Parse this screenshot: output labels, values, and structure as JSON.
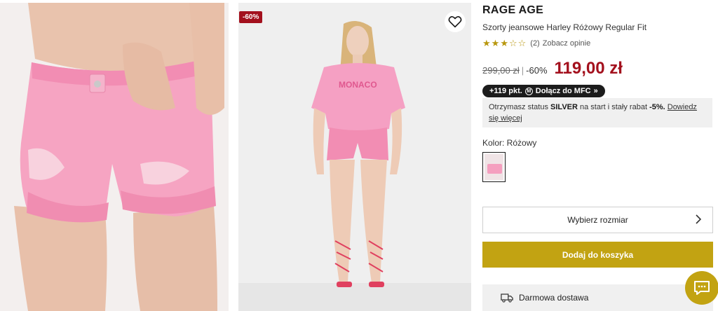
{
  "gallery": {
    "discount_badge": "-60%",
    "wishlist_icon": "heart-icon",
    "right_tee_text": "MONACO"
  },
  "product": {
    "brand": "RAGE AGE",
    "name": "Szorty jeansowe Harley Różowy Regular Fit",
    "rating": {
      "stars_filled": 3,
      "stars_total": 5,
      "count": "(2)",
      "link": "Zobacz opinie"
    },
    "price": {
      "old": "299,00 zł",
      "separator": "|",
      "discount": "-60%",
      "new": "119,00 zł"
    },
    "mfc": {
      "points": "+119 pkt.",
      "icon_letter": "M",
      "join": "Dołącz do MFC",
      "chevron": "»"
    },
    "info": {
      "prefix": "Otrzymasz status ",
      "status": "SILVER",
      "middle": " na start i stały rabat ",
      "rebate": "-5%",
      "dot": ". ",
      "link": "Dowiedz się więcej"
    },
    "color": {
      "label": "Kolor: Różowy"
    },
    "size_select": {
      "label": "Wybierz rozmiar"
    },
    "add_to_cart": "Dodaj do koszyka",
    "delivery": "Darmowa dostawa"
  },
  "colors": {
    "accent": "#c2a312",
    "sale": "#a3101d",
    "pink": "#f59fbf"
  }
}
